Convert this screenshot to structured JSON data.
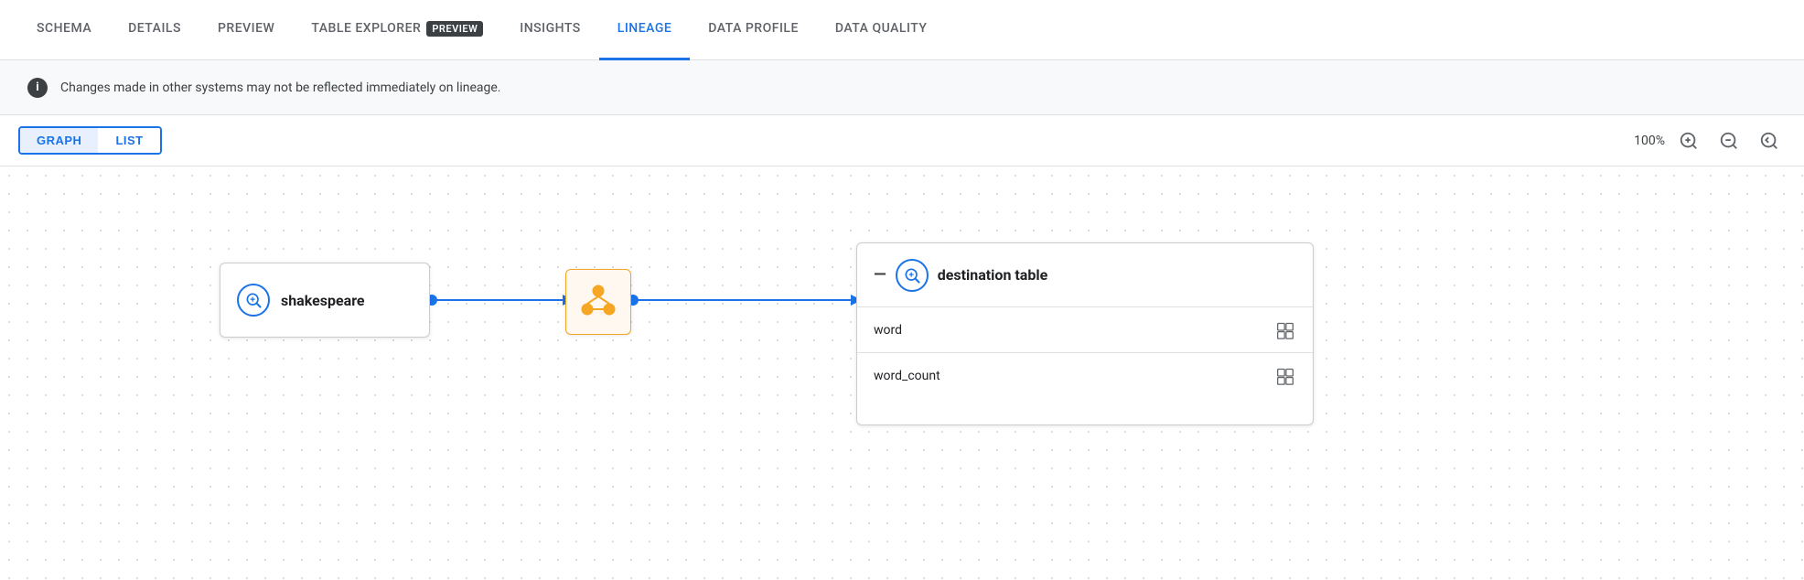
{
  "tabs": [
    {
      "id": "schema",
      "label": "SCHEMA",
      "active": false
    },
    {
      "id": "details",
      "label": "DETAILS",
      "active": false
    },
    {
      "id": "preview",
      "label": "PREVIEW",
      "active": false
    },
    {
      "id": "table-explorer",
      "label": "TABLE EXPLORER",
      "badge": "PREVIEW",
      "active": false
    },
    {
      "id": "insights",
      "label": "INSIGHTS",
      "active": false
    },
    {
      "id": "lineage",
      "label": "LINEAGE",
      "active": true
    },
    {
      "id": "data-profile",
      "label": "DATA PROFILE",
      "active": false
    },
    {
      "id": "data-quality",
      "label": "DATA QUALITY",
      "active": false
    }
  ],
  "info_bar": {
    "text": "Changes made in other systems may not be reflected immediately on lineage."
  },
  "controls": {
    "graph_label": "GRAPH",
    "list_label": "LIST",
    "zoom_percent": "100%"
  },
  "graph": {
    "source_node": {
      "label": "shakespeare"
    },
    "destination_node": {
      "label": "destination table",
      "rows": [
        {
          "field": "word"
        },
        {
          "field": "word_count"
        }
      ]
    }
  }
}
